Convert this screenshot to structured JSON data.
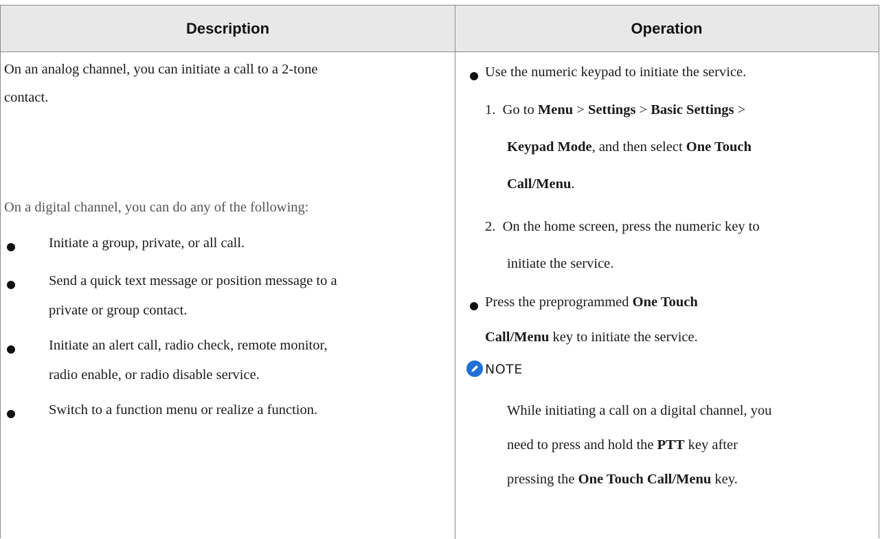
{
  "table": {
    "headers": {
      "description": "Description",
      "operation": "Operation"
    },
    "description": {
      "analog_line1": "On an analog channel, you can initiate a call to a 2-tone",
      "analog_line2": "contact.",
      "digital_intro": "On a digital channel, you can do any of the following:",
      "items": [
        {
          "line1": "Initiate a group, private, or all call.",
          "line2": ""
        },
        {
          "line1": "Send a quick text message or position message to a",
          "line2": "private or group contact."
        },
        {
          "line1": "Initiate an alert call, radio check, remote monitor,",
          "line2": "radio enable, or radio disable service."
        },
        {
          "line1": "Switch to a function menu or realize a function.",
          "line2": ""
        }
      ]
    },
    "operation": {
      "bullet1": "Use the numeric keypad to initiate the service.",
      "step1": {
        "num": "1.",
        "go_to": "Go to",
        "menu": "Menu",
        "sep": ">",
        "settings": "Settings",
        "basic_settings": "Basic Settings",
        "keypad_mode": "Keypad Mode",
        "then_select": ", and then select",
        "one_touch": "One Touch",
        "call_menu": "Call/Menu",
        "period": "."
      },
      "step2": {
        "num": "2.",
        "line1": "On the home screen, press the numeric key to",
        "line2": "initiate the service."
      },
      "bullet2": {
        "press": "Press the preprogrammed",
        "one_touch": "One Touch",
        "call_menu": "Call/Menu",
        "rest": "key to initiate the service."
      },
      "note": {
        "label": "NOTE",
        "line1": "While initiating a call on a digital channel, you",
        "line2_pre": "need to press and hold the",
        "ptt": "PTT",
        "line2_post": "key after",
        "line3_pre": "pressing the",
        "one_touch_call_menu": "One Touch Call/Menu",
        "line3_post": "key."
      }
    }
  },
  "colors": {
    "header_bg": "#e8e8e8",
    "border": "#8a8a8a",
    "note_icon": "#1f6fd6"
  }
}
